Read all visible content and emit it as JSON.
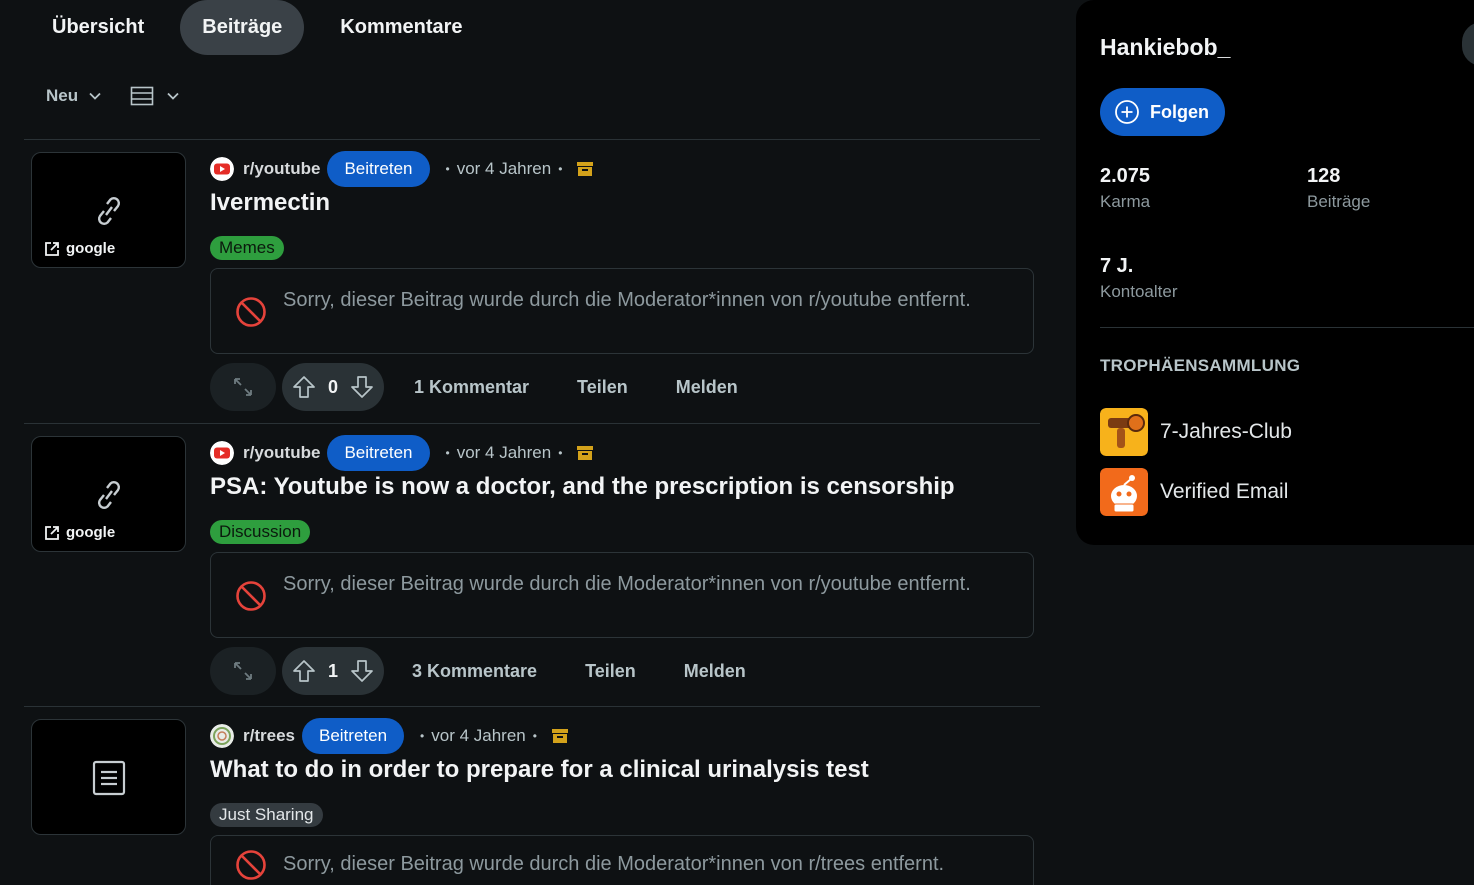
{
  "tabs": [
    {
      "label": "Übersicht",
      "active": false
    },
    {
      "label": "Beiträge",
      "active": true
    },
    {
      "label": "Kommentare",
      "active": false
    }
  ],
  "sort": {
    "label": "Neu",
    "layout_icon": "card-layout-icon"
  },
  "colors": {
    "accent": "#0f5dc7",
    "background": "#0e1113",
    "flair_green": "#2e9e3e",
    "archive": "#d3a21b"
  },
  "posts": [
    {
      "subreddit": "r/youtube",
      "join_label": "Beitreten",
      "age": "vor 4 Jahren",
      "title": "Ivermectin",
      "flair": "Memes",
      "thumb_type": "link",
      "thumb_label": "google",
      "removed_text": "Sorry, dieser Beitrag wurde durch die Moderator*innen von r/youtube entfernt.",
      "votes": "0",
      "comments": "1 Kommentar",
      "share": "Teilen",
      "report": "Melden"
    },
    {
      "subreddit": "r/youtube",
      "join_label": "Beitreten",
      "age": "vor 4 Jahren",
      "title": "PSA: Youtube is now a doctor, and the prescription is censorship",
      "flair": "Discussion",
      "thumb_type": "link",
      "thumb_label": "google",
      "removed_text": "Sorry, dieser Beitrag wurde durch die Moderator*innen von r/youtube entfernt.",
      "votes": "1",
      "comments": "3 Kommentare",
      "share": "Teilen",
      "report": "Melden"
    },
    {
      "subreddit": "r/trees",
      "join_label": "Beitreten",
      "age": "vor 4 Jahren",
      "title": "What to do in order to prepare for a clinical urinalysis test",
      "flair": "Just Sharing",
      "thumb_type": "text",
      "removed_text": "Sorry, dieser Beitrag wurde durch die Moderator*innen von r/trees entfernt."
    }
  ],
  "sidebar": {
    "username": "Hankiebob_",
    "follow_label": "Folgen",
    "karma_value": "2.075",
    "karma_label": "Karma",
    "posts_value": "128",
    "posts_label": "Beiträge",
    "age_value": "7 J.",
    "age_label": "Kontoalter",
    "trophies_heading": "TROPHÄENSAMMLUNG",
    "trophies": [
      {
        "name": "7-Jahres-Club",
        "icon": "seven-year-club-icon"
      },
      {
        "name": "Verified Email",
        "icon": "verified-email-icon"
      }
    ]
  }
}
